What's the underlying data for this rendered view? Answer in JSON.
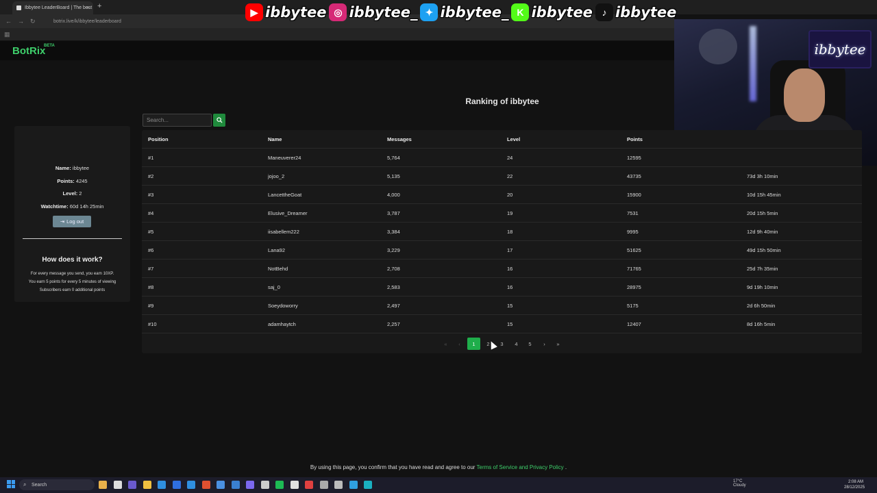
{
  "browser": {
    "tab_title": "Ibbytee LeaderBoard | The best",
    "url": "botrix.live/k/ibbytee/leaderboard"
  },
  "banner": {
    "handles": [
      {
        "platform": "youtube",
        "handle": "ibbytee",
        "color": "#ff0000"
      },
      {
        "platform": "instagram",
        "handle": "ibbytee_",
        "color": "#d62976"
      },
      {
        "platform": "twitter",
        "handle": "ibbytee_",
        "color": "#1da1f2"
      },
      {
        "platform": "kick",
        "handle": "ibbytee",
        "color": "#53fc18"
      },
      {
        "platform": "tiktok",
        "handle": "ibbytee",
        "color": "#111111"
      }
    ]
  },
  "site": {
    "logo": "BotRix",
    "beta": "BETA",
    "accent": "#1fae4b"
  },
  "webcam": {
    "neon_sign": "ibbytee"
  },
  "page": {
    "title": "Ranking of ibbytee",
    "search_placeholder": "Search..."
  },
  "profile": {
    "name_label": "Name:",
    "name": "ibbytee",
    "points_label": "Points:",
    "points": "4245",
    "level_label": "Level:",
    "level": "2",
    "watchtime_label": "Watchtime:",
    "watchtime": "60d 14h 25min",
    "logout_label": "Log out"
  },
  "how": {
    "title": "How does it work?",
    "lines": [
      "For every message you send, you earn 10XP.",
      "You earn 5 points for every 5 minutes of viewing",
      "Subscribers earn 0 additional points"
    ]
  },
  "table": {
    "headers": [
      "Position",
      "Name",
      "Messages",
      "Level",
      "Points"
    ],
    "rows": [
      {
        "position": "#1",
        "name": "Maneuverer24",
        "messages": "5,764",
        "level": "24",
        "points": "12595",
        "watchtime": ""
      },
      {
        "position": "#2",
        "name": "jojoo_2",
        "messages": "5,135",
        "level": "22",
        "points": "43735",
        "watchtime": "73d 3h 10min"
      },
      {
        "position": "#3",
        "name": "LancettheGoat",
        "messages": "4,000",
        "level": "20",
        "points": "15900",
        "watchtime": "10d 15h 45min"
      },
      {
        "position": "#4",
        "name": "Elusive_Dreamer",
        "messages": "3,787",
        "level": "19",
        "points": "7531",
        "watchtime": "20d 15h 5min"
      },
      {
        "position": "#5",
        "name": "iisabellem222",
        "messages": "3,384",
        "level": "18",
        "points": "9995",
        "watchtime": "12d 9h 40min"
      },
      {
        "position": "#6",
        "name": "Lana92",
        "messages": "3,229",
        "level": "17",
        "points": "51625",
        "watchtime": "49d 15h 50min"
      },
      {
        "position": "#7",
        "name": "NotBehd",
        "messages": "2,708",
        "level": "16",
        "points": "71765",
        "watchtime": "25d 7h 35min"
      },
      {
        "position": "#8",
        "name": "saj_0",
        "messages": "2,583",
        "level": "16",
        "points": "28975",
        "watchtime": "9d 19h 10min"
      },
      {
        "position": "#9",
        "name": "Soeydoworry",
        "messages": "2,497",
        "level": "15",
        "points": "5175",
        "watchtime": "2d 6h 50min"
      },
      {
        "position": "#10",
        "name": "adamhaytch",
        "messages": "2,257",
        "level": "15",
        "points": "12407",
        "watchtime": "8d 16h 5min"
      }
    ]
  },
  "pagination": {
    "first": "«",
    "prev": "‹",
    "pages": [
      "1",
      "2",
      "3",
      "4",
      "5"
    ],
    "active": "1",
    "next": "›",
    "last": "»"
  },
  "footer": {
    "text_before": "By using this page, you confirm that you have read and agree to our ",
    "link": "Terms of Service and Privacy Policy",
    "text_after": " ."
  },
  "taskbar": {
    "search_label": "Search",
    "weather_temp": "17°C",
    "weather_text": "Cloudy",
    "time": "2:08 AM",
    "date": "28/12/2025"
  }
}
